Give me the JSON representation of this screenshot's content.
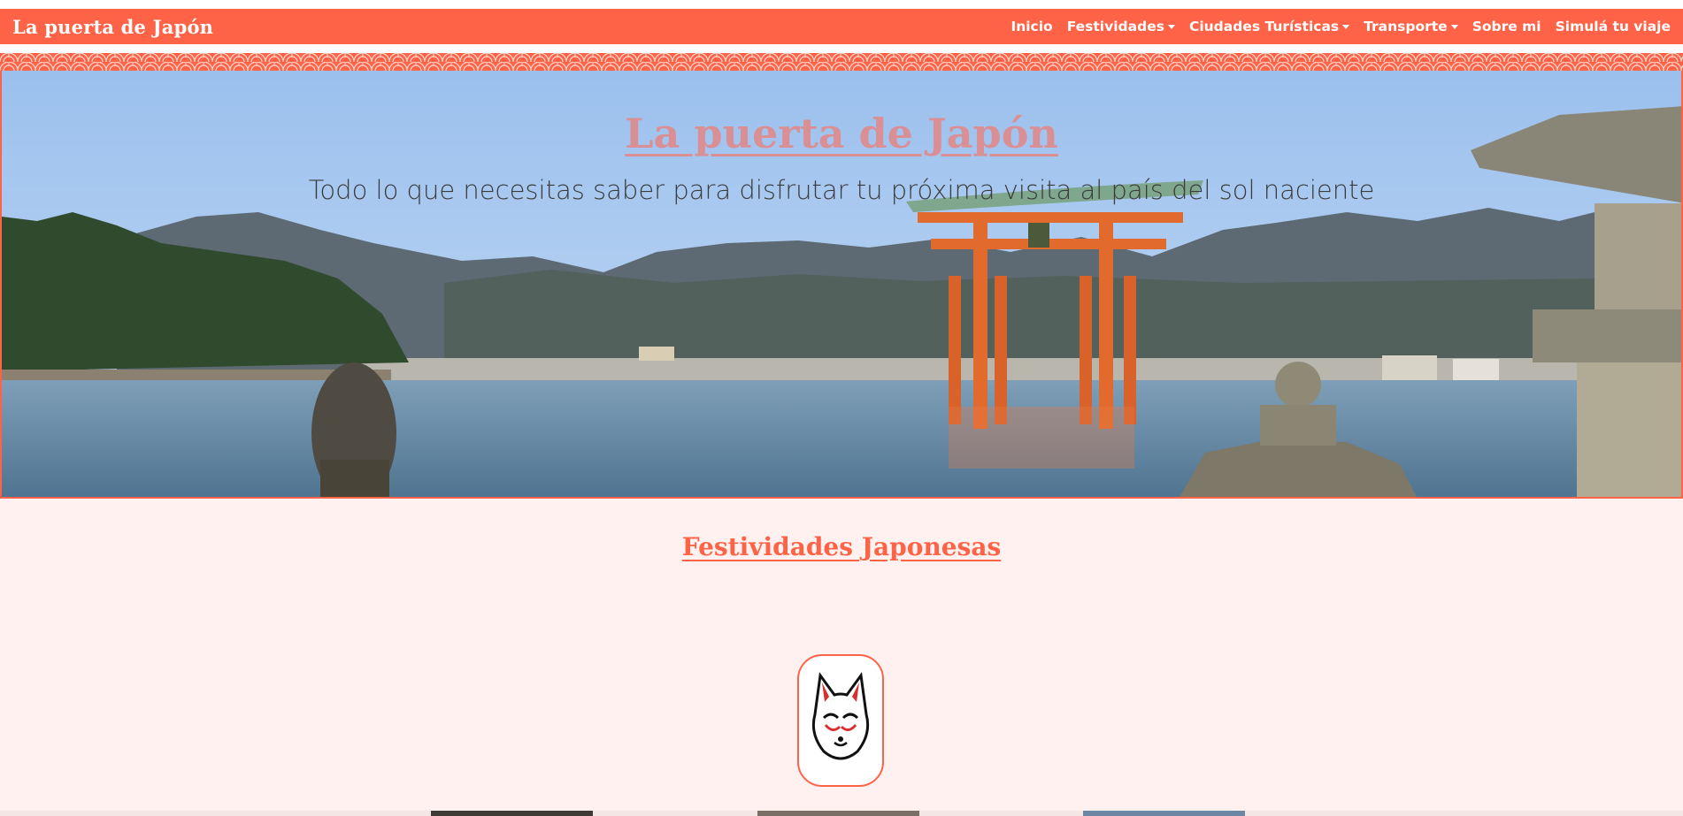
{
  "navbar": {
    "brand": "La puerta de Japón",
    "items": [
      {
        "label": "Inicio",
        "dropdown": false
      },
      {
        "label": "Festividades",
        "dropdown": true
      },
      {
        "label": "Ciudades Turísticas",
        "dropdown": true
      },
      {
        "label": "Transporte",
        "dropdown": true
      },
      {
        "label": "Sobre mi",
        "dropdown": false
      },
      {
        "label": "Simulá tu viaje",
        "dropdown": false
      }
    ]
  },
  "hero": {
    "title": "La puerta de Japón",
    "subtitle": "Todo lo que necesitas saber para disfrutar tu próxima visita al país del sol naciente"
  },
  "section": {
    "title": "Festividades Japonesas",
    "card_icon": "kitsune-mask-icon"
  },
  "colors": {
    "accent": "#ff6347",
    "background": "#fff1ef",
    "hero_title": "#d98f93"
  }
}
